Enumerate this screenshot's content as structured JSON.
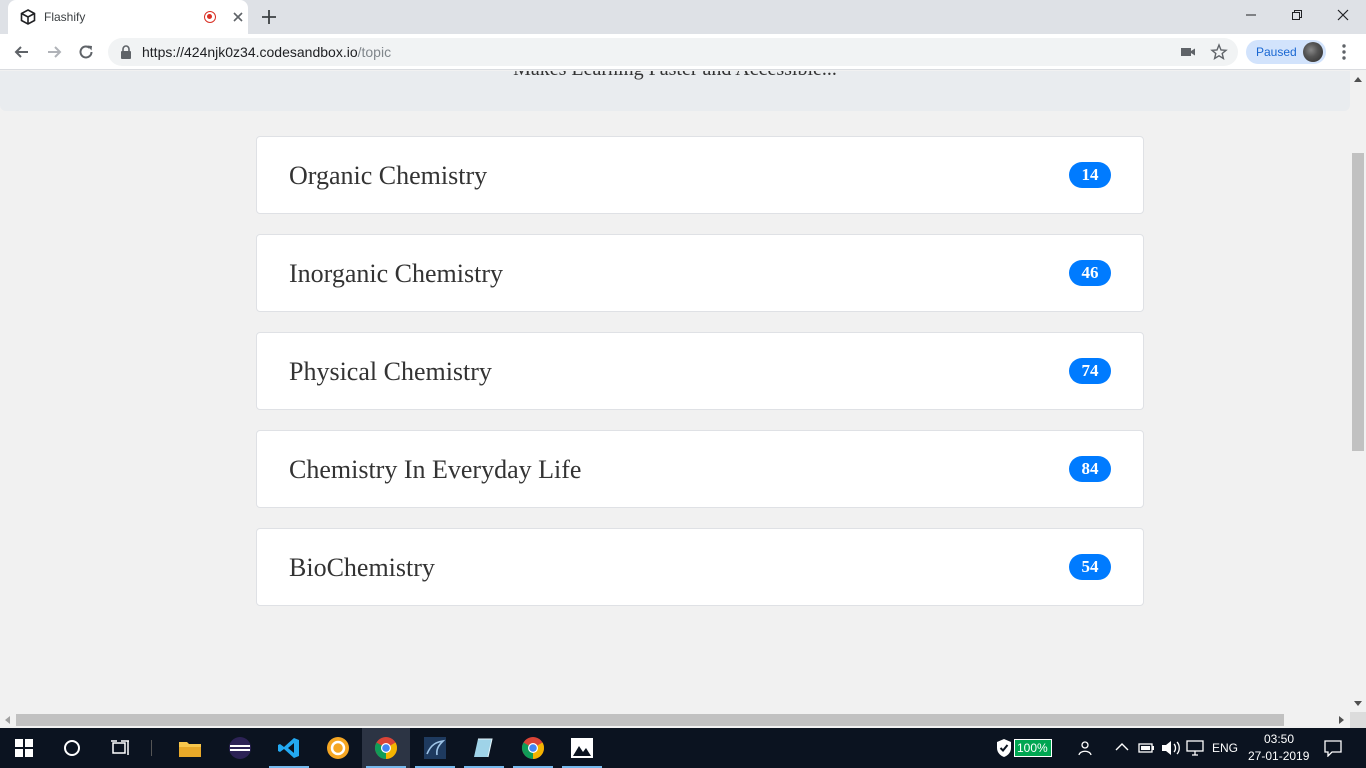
{
  "browser": {
    "tab_title": "Flashify",
    "url_host": "https://424njk0z34.codesandbox.io",
    "url_path": "/topic",
    "paused_label": "Paused",
    "accent": "#1a73e8"
  },
  "page": {
    "tagline": "Makes Learning Faster and Accessible...",
    "topics": [
      {
        "name": "Organic Chemistry",
        "count": "14"
      },
      {
        "name": "Inorganic Chemistry",
        "count": "46"
      },
      {
        "name": "Physical Chemistry",
        "count": "74"
      },
      {
        "name": "Chemistry In Everyday Life",
        "count": "84"
      },
      {
        "name": "BioChemistry",
        "count": "54"
      }
    ],
    "badge_color": "#007bff"
  },
  "taskbar": {
    "battery": "100%",
    "language": "ENG",
    "time": "03:50",
    "date": "27-01-2019"
  }
}
